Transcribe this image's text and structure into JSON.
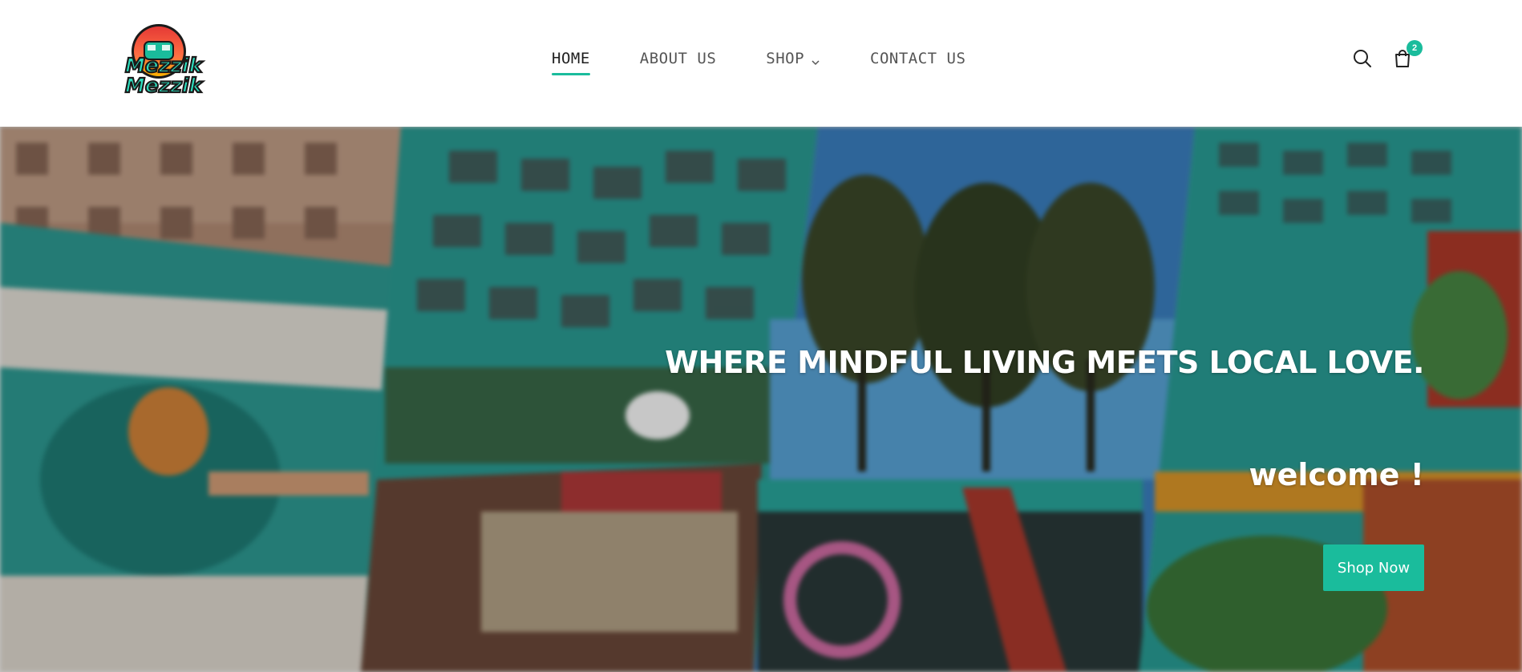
{
  "brand": {
    "logo_text_line1": "Mezzik",
    "logo_text_line2": "Mezzik",
    "accent_color": "#1abc9c"
  },
  "nav": {
    "items": [
      {
        "label": "HOME",
        "active": true
      },
      {
        "label": "ABOUT US",
        "active": false
      },
      {
        "label": "SHOP",
        "active": false,
        "has_dropdown": true
      },
      {
        "label": "CONTACT US",
        "active": false
      }
    ]
  },
  "header_icons": {
    "search": "search-icon",
    "cart": "shopping-bag-icon",
    "cart_count": "2"
  },
  "hero": {
    "headline": "WHERE MINDFUL LIVING MEETS LOCAL LOVE.",
    "subheadline": "welcome !",
    "cta_label": "Shop Now"
  }
}
